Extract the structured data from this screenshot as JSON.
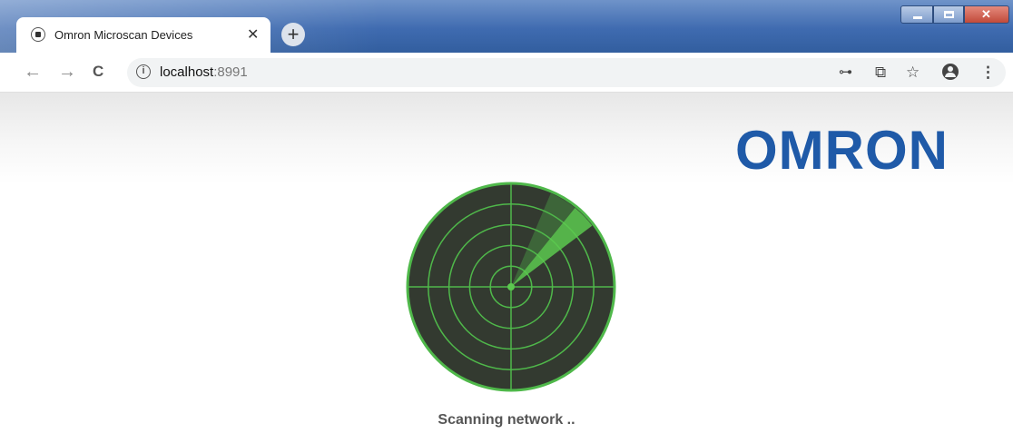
{
  "browser": {
    "tab": {
      "title": "Omron Microscan Devices",
      "close_glyph": "✕",
      "favicon": "record-icon"
    },
    "new_tab_glyph": "+",
    "window_controls": [
      "minimize",
      "maximize",
      "close"
    ],
    "nav": {
      "back_glyph": "←",
      "forward_glyph": "→",
      "reload_glyph": "C"
    },
    "address": {
      "host": "localhost",
      "port": ":8991",
      "info_glyph": "i"
    },
    "toolbar_icons": {
      "key": "key-icon",
      "translate": "translate-icon",
      "star": "star-icon",
      "account": "account-icon",
      "menu": "menu-icon"
    },
    "toolbar_glyphs": {
      "key": "⊶",
      "translate": "⧉",
      "star": "☆",
      "menu": "⋮"
    }
  },
  "page": {
    "logo": "OMRON",
    "status": "Scanning network ..",
    "radar": {
      "icon": "radar-icon",
      "rings": 4,
      "sweep_angle_deg": 45
    }
  },
  "colors": {
    "brand_blue": "#1f5aa8",
    "radar_bg": "#333a30",
    "radar_line": "#4fb84a",
    "radar_sweep": "#5cc94f",
    "titlebar": "#3f6bb0"
  }
}
